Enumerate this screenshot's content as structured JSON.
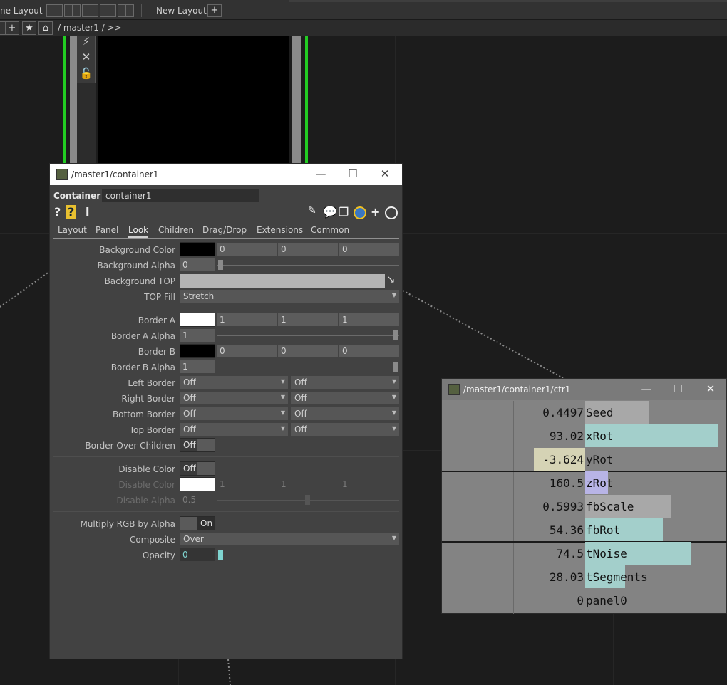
{
  "topbar": {
    "pane_layout_label": "ne Layout",
    "new_layout_label": "New Layout",
    "plus_label": "+"
  },
  "pathbar": {
    "plus_label": "+",
    "star_label": "★",
    "home_label": "⌂",
    "path": "/ master1 / >>"
  },
  "param_dialog": {
    "title": "/master1/container1",
    "op_type": "Container",
    "op_name": "container1",
    "tabs": [
      "Layout",
      "Panel",
      "Look",
      "Children",
      "Drag/Drop",
      "Extensions",
      "Common"
    ],
    "active_tab": "Look",
    "params": {
      "bg_color": {
        "label": "Background Color",
        "values": [
          "0",
          "0",
          "0"
        ],
        "swatch": "#000000"
      },
      "bg_alpha": {
        "label": "Background Alpha",
        "value": "0"
      },
      "bg_top": {
        "label": "Background TOP"
      },
      "top_fill": {
        "label": "TOP Fill",
        "value": "Stretch"
      },
      "border_a": {
        "label": "Border A",
        "values": [
          "1",
          "1",
          "1"
        ],
        "swatch": "#ffffff"
      },
      "border_a_alpha": {
        "label": "Border A Alpha",
        "value": "1"
      },
      "border_b": {
        "label": "Border B",
        "values": [
          "0",
          "0",
          "0"
        ],
        "swatch": "#000000"
      },
      "border_b_alpha": {
        "label": "Border B Alpha",
        "value": "1"
      },
      "left_border": {
        "label": "Left Border",
        "values": [
          "Off",
          "Off"
        ]
      },
      "right_border": {
        "label": "Right Border",
        "values": [
          "Off",
          "Off"
        ]
      },
      "bottom_border": {
        "label": "Bottom Border",
        "values": [
          "Off",
          "Off"
        ]
      },
      "top_border": {
        "label": "Top Border",
        "values": [
          "Off",
          "Off"
        ]
      },
      "border_over_children": {
        "label": "Border Over Children",
        "value": "Off"
      },
      "disable_color_toggle": {
        "label": "Disable Color",
        "value": "Off"
      },
      "disable_color": {
        "label": "Disable Color",
        "values": [
          "1",
          "1",
          "1"
        ],
        "swatch": "#ffffff"
      },
      "disable_alpha": {
        "label": "Disable Alpha",
        "value": "0.5"
      },
      "multiply_rgb": {
        "label": "Multiply RGB by Alpha",
        "value": "On"
      },
      "composite": {
        "label": "Composite",
        "value": "Over"
      },
      "opacity": {
        "label": "Opacity",
        "value": "0"
      }
    }
  },
  "ctrl_panel": {
    "title": "/master1/container1/ctr1",
    "sliders": [
      {
        "name": "Seed",
        "value": "0.4497",
        "fraction": 0.4497,
        "color": "#a8a8a8"
      },
      {
        "name": "xRot",
        "value": "93.02",
        "fraction": 0.93,
        "color": "#a3cfcb"
      },
      {
        "name": "yRot",
        "value": "-3.624",
        "fraction": -0.36,
        "color": "#d5d3b5"
      },
      {
        "name": "zRot",
        "value": "160.5",
        "fraction": 0.16,
        "color": "#b8b4e6"
      },
      {
        "name": "fbScale",
        "value": "0.5993",
        "fraction": 0.5993,
        "color": "#a8a8a8"
      },
      {
        "name": "fbRot",
        "value": "54.36",
        "fraction": 0.5436,
        "color": "#a3cfcb"
      },
      {
        "name": "tNoise",
        "value": "74.5",
        "fraction": 0.745,
        "color": "#a3cfcb"
      },
      {
        "name": "tSegments",
        "value": "28.03",
        "fraction": 0.28,
        "color": "#a3cfcb"
      },
      {
        "name": "panel0",
        "value": "0",
        "fraction": 0,
        "color": "#a3cfcb"
      }
    ]
  }
}
